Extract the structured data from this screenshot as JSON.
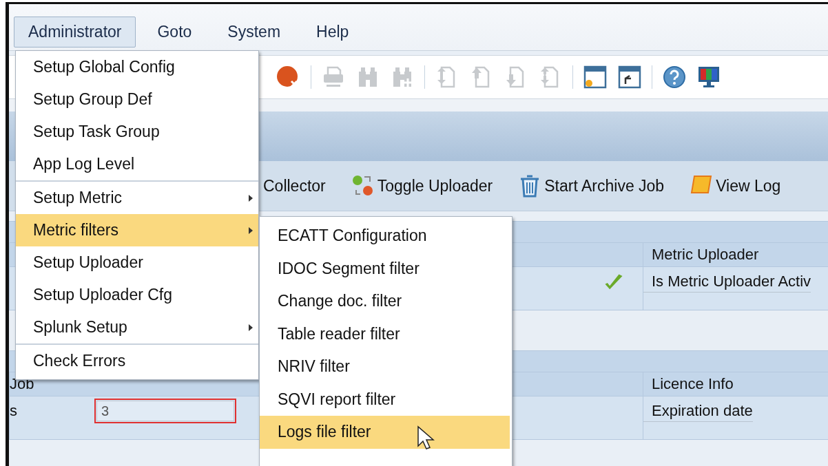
{
  "menubar": [
    {
      "label": "Administrator",
      "selected": true
    },
    {
      "label": "Goto",
      "selected": false
    },
    {
      "label": "System",
      "selected": false
    },
    {
      "label": "Help",
      "selected": false
    }
  ],
  "app_toolbar": [
    {
      "label": "Collector",
      "kind": "plain"
    },
    {
      "label": "Toggle Uploader",
      "kind": "toggle"
    },
    {
      "label": "Start Archive Job",
      "kind": "archive"
    },
    {
      "label": "View Log",
      "kind": "log"
    }
  ],
  "metric_section": {
    "active": true,
    "heading": "Metric Uploader",
    "field_label": "Is Metric Uploader Activ"
  },
  "job_section": {
    "heading": "Job",
    "row_label": "s",
    "input_value": "3",
    "licence_heading": "Licence Info",
    "licence_field": "Expiration date"
  },
  "menu": {
    "groups": [
      [
        {
          "label": "Setup Global Config",
          "has_submenu": false,
          "selected": false
        },
        {
          "label": "Setup Group Def",
          "has_submenu": false,
          "selected": false
        },
        {
          "label": "Setup Task Group",
          "has_submenu": false,
          "selected": false
        },
        {
          "label": "App Log Level",
          "has_submenu": false,
          "selected": false
        }
      ],
      [
        {
          "label": "Setup Metric",
          "has_submenu": true,
          "selected": false
        },
        {
          "label": "Metric filters",
          "has_submenu": true,
          "selected": true
        },
        {
          "label": "Setup Uploader",
          "has_submenu": false,
          "selected": false
        },
        {
          "label": "Setup Uploader Cfg",
          "has_submenu": false,
          "selected": false
        },
        {
          "label": "Splunk Setup",
          "has_submenu": true,
          "selected": false
        }
      ],
      [
        {
          "label": "Check Errors",
          "has_submenu": false,
          "selected": false
        }
      ]
    ]
  },
  "submenu": {
    "items": [
      {
        "label": "ECATT Configuration",
        "selected": false
      },
      {
        "label": "IDOC Segment filter",
        "selected": false
      },
      {
        "label": "Change doc. filter",
        "selected": false
      },
      {
        "label": "Table reader filter",
        "selected": false
      },
      {
        "label": "NRIV filter",
        "selected": false
      },
      {
        "label": "SQVI report filter",
        "selected": false
      },
      {
        "label": "Logs file filter",
        "selected": true
      }
    ]
  }
}
